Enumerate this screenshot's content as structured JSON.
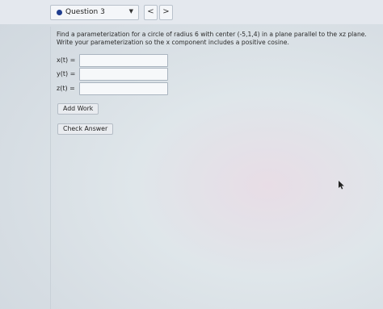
{
  "nav": {
    "question_label": "Question 3",
    "prev_symbol": "<",
    "next_symbol": ">"
  },
  "problem": {
    "text": "Find a parameterization for a circle of radius 6 with center (-5,1,4) in a plane parallel to the xz plane. Write your parameterization so the x component includes a positive cosine."
  },
  "fields": [
    {
      "label": "x(t) =",
      "value": ""
    },
    {
      "label": "y(t) =",
      "value": ""
    },
    {
      "label": "z(t) =",
      "value": ""
    }
  ],
  "buttons": {
    "add_work": "Add Work",
    "check_answer": "Check Answer"
  },
  "colors": {
    "accent_dot": "#1f3d8f"
  }
}
